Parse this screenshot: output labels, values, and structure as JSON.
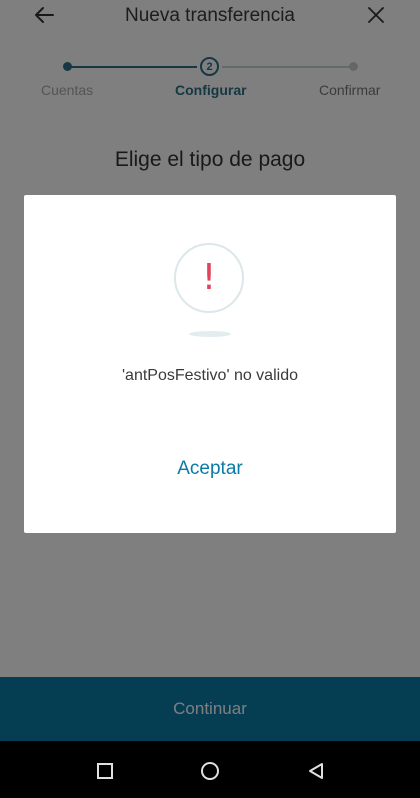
{
  "header": {
    "title": "Nueva transferencia"
  },
  "stepper": {
    "steps": [
      {
        "label": "Cuentas"
      },
      {
        "label": "Configurar",
        "number": "2"
      },
      {
        "label": "Confirmar"
      }
    ]
  },
  "main": {
    "subtitle": "Elige el tipo de pago",
    "continue_label": "Continuar"
  },
  "dialog": {
    "icon": "exclamation-icon",
    "message": "'antPosFestivo' no valido",
    "accept_label": "Aceptar"
  },
  "navbar": {
    "icons": [
      "recent-apps-icon",
      "home-icon",
      "back-icon"
    ]
  },
  "colors": {
    "accent": "#0b7aa6",
    "stepper": "#2d6f87",
    "alert": "#e0435a"
  }
}
